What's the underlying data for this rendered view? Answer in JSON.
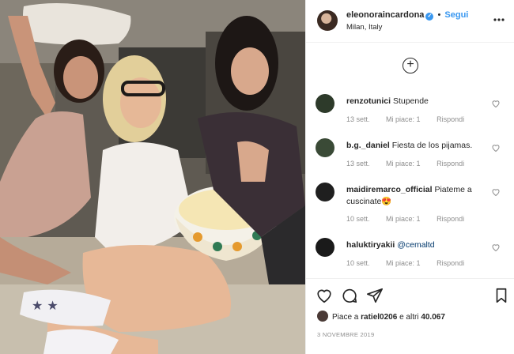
{
  "post": {
    "username": "eleonoraincardona",
    "verified_mark": "✓",
    "separator": "•",
    "follow_label": "Segui",
    "location": "Milan, Italy",
    "more_icon": "more-horizontal-icon",
    "load_more_icon": "plus-circle-icon"
  },
  "comments": [
    {
      "user": "renzotunici",
      "text": "Stupende",
      "date": "13 sett.",
      "likes": "Mi piace: 1",
      "reply": "Rispondi",
      "avatar_color": "#2d3a2a"
    },
    {
      "user": "b.g._daniel",
      "text": "Fiesta de los pijamas.",
      "date": "13 sett.",
      "likes": "Mi piace: 1",
      "reply": "Rispondi",
      "avatar_color": "#3a4a36"
    },
    {
      "user": "maidiremarco_official",
      "text": "Piateme a cuscinate😍",
      "date": "10 sett.",
      "likes": "Mi piace: 1",
      "reply": "Rispondi",
      "avatar_color": "#1f1f1f"
    },
    {
      "user": "haluktiryakii",
      "text": "@cemaltd",
      "date": "10 sett.",
      "likes": "Mi piace: 1",
      "reply": "Rispondi",
      "avatar_color": "#1a1a1a"
    }
  ],
  "footer": {
    "like_prefix": "Piace a",
    "like_user": "ratiel0206",
    "like_middle": "e altri",
    "like_count": "40.067",
    "date": "3 NOVEMBRE 2019"
  },
  "colors": {
    "link": "#3897f0",
    "muted": "#8e8e8e",
    "text": "#262626",
    "border": "#efefef"
  }
}
